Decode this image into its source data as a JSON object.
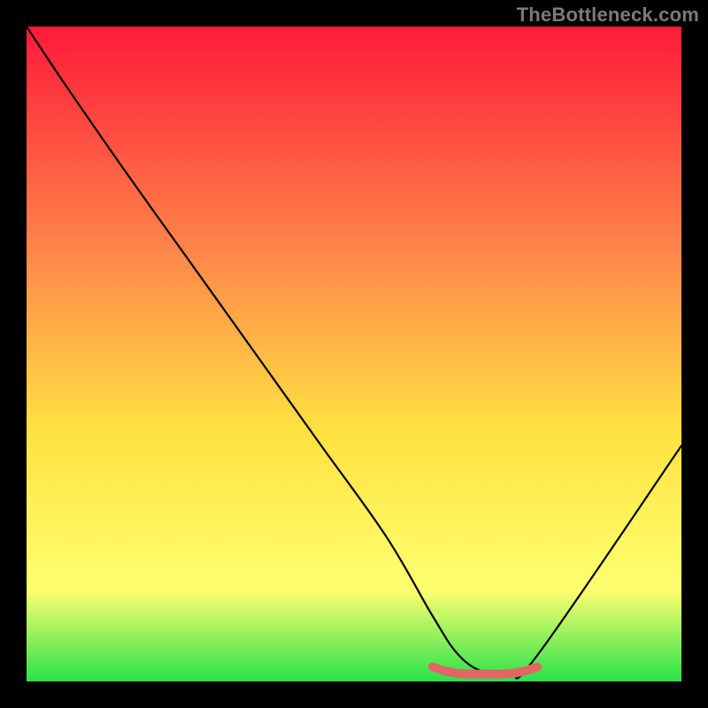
{
  "watermark": "TheBottleneck.com",
  "chart_data": {
    "type": "line",
    "title": "",
    "xlabel": "",
    "ylabel": "",
    "xlim": [
      0,
      100
    ],
    "ylim": [
      0,
      100
    ],
    "x": [
      0,
      6,
      15,
      25,
      35,
      45,
      55,
      62,
      66,
      70,
      74,
      78,
      100
    ],
    "series": [
      {
        "name": "curve",
        "values": [
          100,
          91,
          78,
          64,
          50,
          36,
          22,
          10,
          4,
          1.4,
          1.4,
          4,
          36
        ]
      }
    ],
    "trough_highlight": {
      "x_start": 62,
      "x_end": 78,
      "y": 1.4
    },
    "colors": {
      "gradient_top": "#ff1a3a",
      "gradient_mid1": "#ff884a",
      "gradient_mid2": "#ffe241",
      "gradient_mid3": "#ffff70",
      "gradient_bottom": "#29e24a",
      "curve": "#000000",
      "trough": "#e16666",
      "frame": "#000000"
    }
  }
}
